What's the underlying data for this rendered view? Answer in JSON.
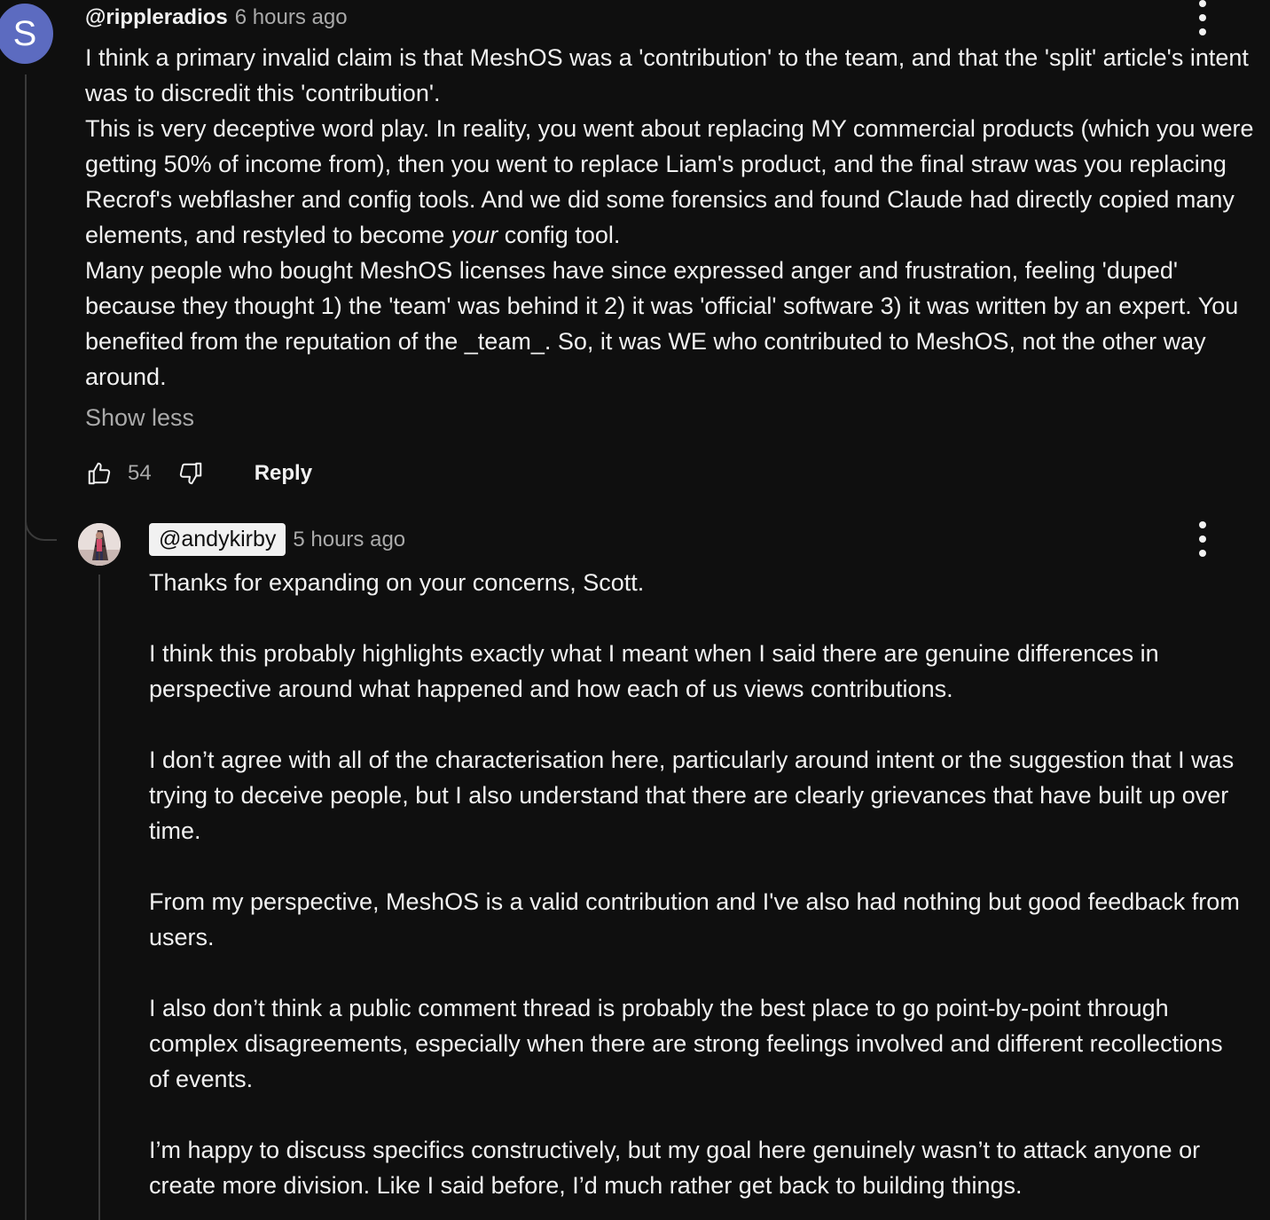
{
  "comment": {
    "avatar_letter": "S",
    "avatar_color": "#5c6bc0",
    "handle": "@rippleradios",
    "time": "6 hours ago",
    "paragraphs": [
      "I think a primary invalid claim is that MeshOS was a 'contribution' to the team, and that the 'split' article's intent was to discredit this 'contribution'.",
      "This is very deceptive word play. In reality, you went about replacing MY commercial products (which you were getting 50% of income from), then you went to replace Liam's product, and the final straw was you replacing Recrof's webflasher and config tools. And we did some forensics and found Claude had directly copied many elements, and restyled to become ",
      "Many people who bought MeshOS licenses have since expressed anger and frustration, feeling 'duped' because they thought 1) the 'team' was behind it 2) it was 'official' software 3) it was written by an expert. You benefited from the reputation of the _team_. So, it was WE who contributed to MeshOS, not the other way around."
    ],
    "emphasis_word": "your",
    "emphasis_tail": " config tool.",
    "show_less_label": "Show less",
    "like_count": "54",
    "reply_label": "Reply",
    "like_icon": "thumbs-up-icon",
    "dislike_icon": "thumbs-down-icon",
    "menu_icon": "more-vert-icon"
  },
  "reply": {
    "handle": "@andykirby",
    "time": "5 hours ago",
    "menu_icon": "more-vert-icon",
    "paragraphs": [
      "Thanks for expanding on your concerns, Scott.",
      "I think this probably highlights exactly what I meant when I said there are genuine differences in perspective around what happened and how each of us views contributions.",
      "I don’t agree with all of the characterisation here, particularly around intent or the suggestion that I was trying to deceive people, but I also understand that there are clearly grievances that have built up over time.",
      "From my perspective, MeshOS is a valid contribution and I've also had nothing but good feedback from users.",
      "I also don’t think a public comment thread is probably the best place to go point-by-point through complex disagreements, especially when there are strong feelings involved and different recollections of events.",
      "I’m happy to discuss specifics constructively, but my goal here genuinely wasn’t to attack anyone or create more division. Like I said before, I’d much rather get back to building things."
    ]
  }
}
